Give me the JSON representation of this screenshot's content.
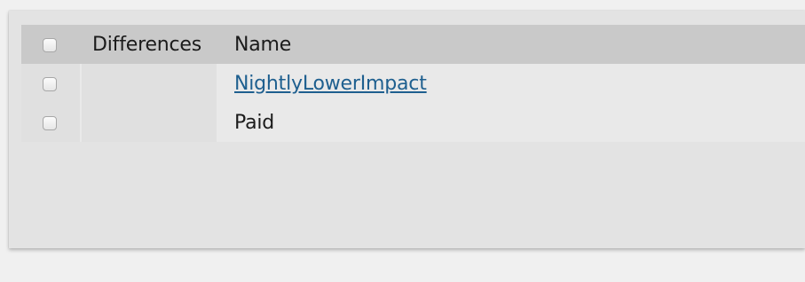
{
  "table": {
    "headers": {
      "differences": "Differences",
      "name": "Name"
    },
    "rows": [
      {
        "name": "NightlyLowerImpact",
        "is_link": true
      },
      {
        "name": "Paid",
        "is_link": false
      }
    ]
  },
  "colors": {
    "link": "#1e5f8f",
    "header_bg": "#c9c9c9",
    "panel_bg": "#e3e3e3"
  }
}
